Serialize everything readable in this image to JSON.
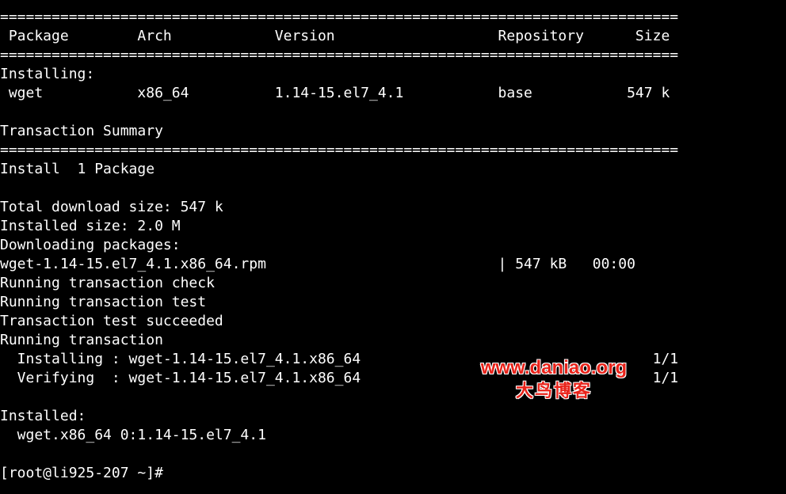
{
  "terminal": {
    "lines": [
      "===============================================================================",
      " Package        Arch            Version                   Repository      Size",
      "===============================================================================",
      "Installing:",
      " wget           x86_64          1.14-15.el7_4.1           base           547 k",
      "",
      "Transaction Summary",
      "===============================================================================",
      "Install  1 Package",
      "",
      "Total download size: 547 k",
      "Installed size: 2.0 M",
      "Downloading packages:",
      "wget-1.14-15.el7_4.1.x86_64.rpm                           | 547 kB   00:00",
      "Running transaction check",
      "Running transaction test",
      "Transaction test succeeded",
      "Running transaction",
      "  Installing : wget-1.14-15.el7_4.1.x86_64                                  1/1",
      "  Verifying  : wget-1.14-15.el7_4.1.x86_64                                  1/1",
      "",
      "Installed:",
      "  wget.x86_64 0:1.14-15.el7_4.1",
      "",
      "[root@li925-207 ~]#"
    ]
  },
  "watermark": {
    "url": "www.daniao.org",
    "name": "大鸟博客",
    "color": "#e8231a"
  },
  "colors": {
    "background": "#000000",
    "foreground": "#ffffff"
  }
}
